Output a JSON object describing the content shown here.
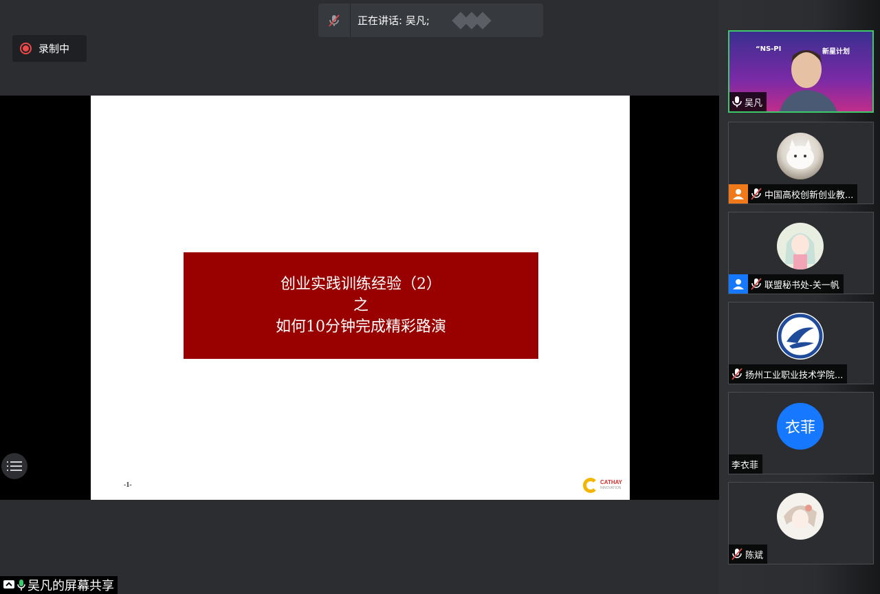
{
  "recording": {
    "label": "录制中"
  },
  "speaking": {
    "label": "正在讲话: 吴凡;"
  },
  "slide": {
    "title_line1": "创业实践训练经验（2）",
    "title_line2": "之",
    "title_line3": "如何10分钟完成精彩路演",
    "page_number": "-1-",
    "logo_name": "CATHAY",
    "logo_sub": "INNOVATION"
  },
  "share": {
    "label": "吴凡的屏幕共享"
  },
  "participants": [
    {
      "name": "吴凡",
      "banner_left": "“NS-PI",
      "banner_right": "新星计划",
      "video": true,
      "muted": false
    },
    {
      "name": "中国高校创新创业教...",
      "avatar": "cat-photo",
      "muted": true,
      "role_icon": "orange"
    },
    {
      "name": "联盟秘书处-关一帆",
      "avatar": "anime-girl",
      "muted": true,
      "role_icon": "blue"
    },
    {
      "name": "扬州工业职业技术学院...",
      "avatar": "school-logo",
      "muted": true
    },
    {
      "name": "李衣菲",
      "avatar_text": "衣菲",
      "muted": false
    },
    {
      "name": "陈斌",
      "avatar": "sketch-girl",
      "muted": true
    }
  ],
  "colors": {
    "slide_title_bg": "#990000",
    "recording_red": "#f04848",
    "active_speaker_border": "#3ec96a",
    "avatar_blue": "#1677ff"
  }
}
